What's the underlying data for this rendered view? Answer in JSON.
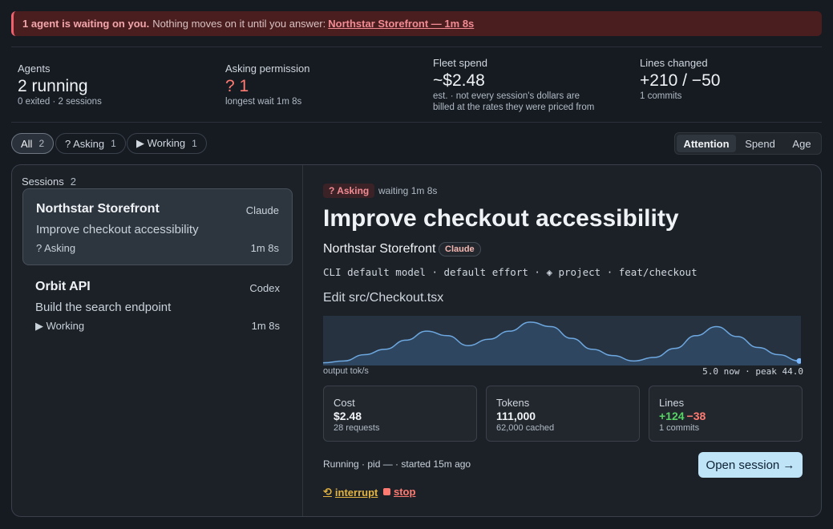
{
  "banner": {
    "strong": "1 agent is waiting on you.",
    "text": "Nothing moves on it until you answer:",
    "link": "Northstar Storefront — 1m 8s"
  },
  "stats": {
    "agents": {
      "label": "Agents",
      "value": "2 running",
      "sub": "0 exited · 2 sessions"
    },
    "asking": {
      "label": "Asking permission",
      "value": "? 1",
      "sub": "longest wait 1m 8s"
    },
    "fleet": {
      "label": "Fleet spend",
      "value": "~$2.48",
      "sub1": "est. · not every session's dollars are",
      "sub2": "billed at the rates they were priced from"
    },
    "lines": {
      "label": "Lines changed",
      "value": "+210 / −50",
      "sub": "1 commits"
    }
  },
  "filters": [
    {
      "label": "All",
      "count": "2"
    },
    {
      "label": "? Asking",
      "count": "1"
    },
    {
      "label": "▶ Working",
      "count": "1"
    }
  ],
  "sort": {
    "options": [
      "Attention",
      "Spend",
      "Age"
    ],
    "selected": "Attention"
  },
  "sessions": {
    "header": "Sessions",
    "count": "2",
    "items": [
      {
        "name": "Northstar Storefront",
        "agent": "Claude",
        "task": "Improve checkout accessibility",
        "state": "? Asking",
        "time": "1m 8s"
      },
      {
        "name": "Orbit API",
        "agent": "Codex",
        "task": "Build the search endpoint",
        "state": "▶ Working",
        "time": "1m 8s"
      }
    ]
  },
  "detail": {
    "status": "? Asking",
    "waiting": "waiting 1m 8s",
    "title": "Improve checkout accessibility",
    "project": "Northstar Storefront",
    "agent": "Claude",
    "meta": "CLI default model · default effort · ◈ project · feat/checkout",
    "current": "Edit src/Checkout.tsx",
    "chart_label": "output tok/s",
    "chart_now": "5.0 now · peak 44.0",
    "cost": {
      "label": "Cost",
      "value": "$2.48",
      "sub": "28 requests"
    },
    "tokens": {
      "label": "Tokens",
      "value": "111,000",
      "sub": "62,000 cached"
    },
    "lines": {
      "label": "Lines",
      "added": "+124",
      "removed": "−38",
      "sub": "1 commits"
    },
    "running": "Running · pid — · started 15m ago",
    "open_button": "Open session →",
    "interrupt": "interrupt",
    "stop": "stop"
  },
  "chart_data": {
    "type": "area",
    "values": [
      3,
      5,
      12,
      18,
      28,
      38,
      33,
      22,
      29,
      38,
      48,
      43,
      30,
      18,
      11,
      5,
      9,
      19,
      33,
      43,
      32,
      20,
      12,
      5
    ],
    "ylim": [
      0,
      55
    ],
    "xlabel": "",
    "ylabel": "output tok/s"
  },
  "colors": {
    "accent_red": "#ff7b72",
    "accent_green": "#56d364",
    "open_button_bg": "#bfe3f7"
  }
}
